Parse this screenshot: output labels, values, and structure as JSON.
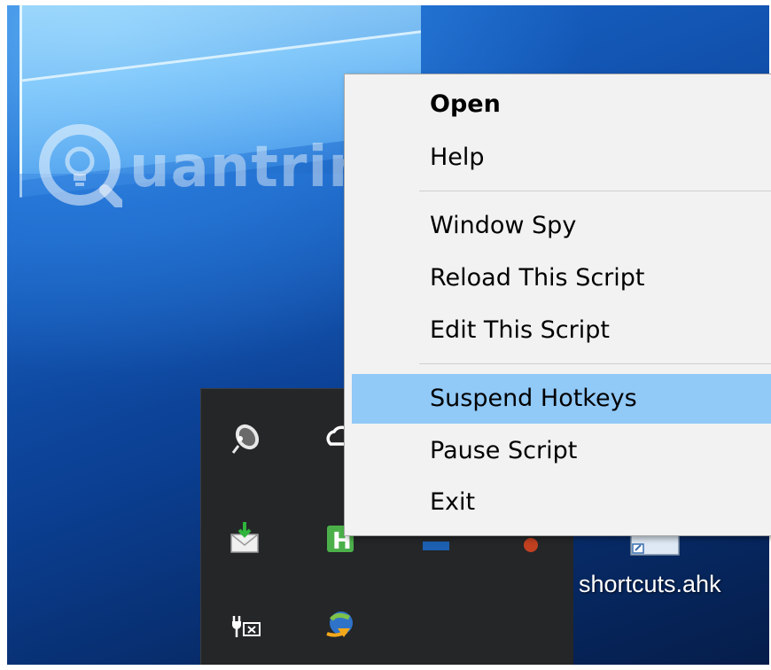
{
  "context_menu": {
    "items": [
      {
        "label": "Open",
        "bold": true
      },
      {
        "label": "Help"
      },
      {
        "label": "Window Spy"
      },
      {
        "label": "Reload This Script"
      },
      {
        "label": "Edit This Script"
      },
      {
        "label": "Suspend Hotkeys",
        "highlighted": true
      },
      {
        "label": "Pause Script"
      },
      {
        "label": "Exit"
      }
    ],
    "highlight_color": "#91c9f7"
  },
  "tray": {
    "icons": [
      "satellite-dish-icon",
      "cloud-icon",
      "mail-download-icon",
      "h-app-icon",
      "battery-plug-icon",
      "internet-download-manager-icon"
    ]
  },
  "desktop": {
    "file_label": "shortcuts.ahk"
  },
  "watermark": {
    "text": "uantrimang"
  }
}
